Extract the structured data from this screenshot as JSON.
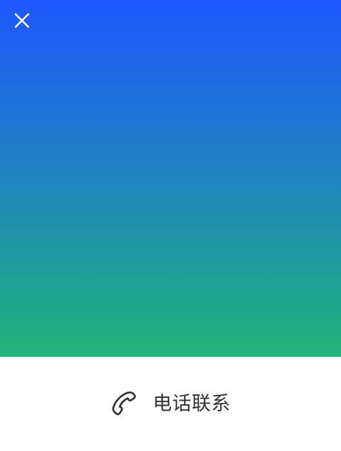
{
  "hero": {
    "gradient_top": "#1f57ff",
    "gradient_mid": "#1f86bf",
    "gradient_bottom": "#22b478"
  },
  "header": {
    "close_icon": "close-icon"
  },
  "footer": {
    "call_label": "电话联系",
    "call_icon": "phone-icon"
  }
}
